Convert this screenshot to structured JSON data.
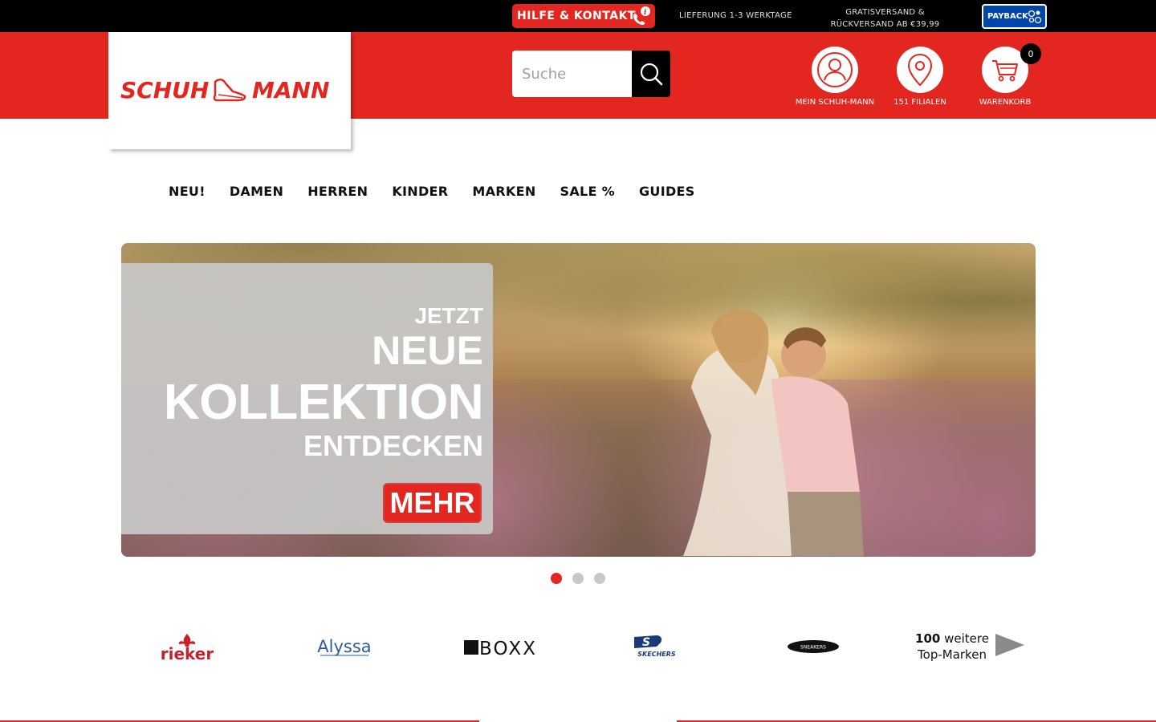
{
  "topbar": {
    "help_label": "HILFE & KONTAKT",
    "delivery_text": "LIEFERUNG 1-3 WERKTAGE",
    "shipping_line1": "GRATISVERSAND &",
    "shipping_line2": "RÜCKVERSAND AB €39,99",
    "payback_label": "PAYBACK"
  },
  "header": {
    "logo_left": "SCHUH",
    "logo_right": "MANN",
    "search_placeholder": "Suche",
    "account_label": "MEIN SCHUH-MANN ",
    "stores_label": "151 FILIALEN",
    "cart_label": "WARENKORB",
    "cart_count": "0",
    "brand_color": "#e3261f"
  },
  "nav": {
    "home_icon": "",
    "items": [
      {
        "label": "NEU!"
      },
      {
        "label": "DAMEN "
      },
      {
        "label": "HERREN "
      },
      {
        "label": "KINDER "
      },
      {
        "label": "MARKEN"
      },
      {
        "label": "SALE %"
      },
      {
        "label": "GUIDES "
      }
    ]
  },
  "hero": {
    "line1": "JETZT",
    "line2": "NEUE",
    "line3": "KOLLEKTION",
    "line4": "ENTDECKEN",
    "button_label": "MEHR",
    "active_slide": 1,
    "slide_count": 3
  },
  "brands": {
    "items": [
      {
        "name": "rieker"
      },
      {
        "name": "Alyssa"
      },
      {
        "name": "BOXX"
      },
      {
        "name": "SKECHERS"
      },
      {
        "name": "SNEAKERS"
      }
    ],
    "more_line1": "100",
    "more_line1b": " weitere",
    "more_line2": "Top-Marken"
  }
}
